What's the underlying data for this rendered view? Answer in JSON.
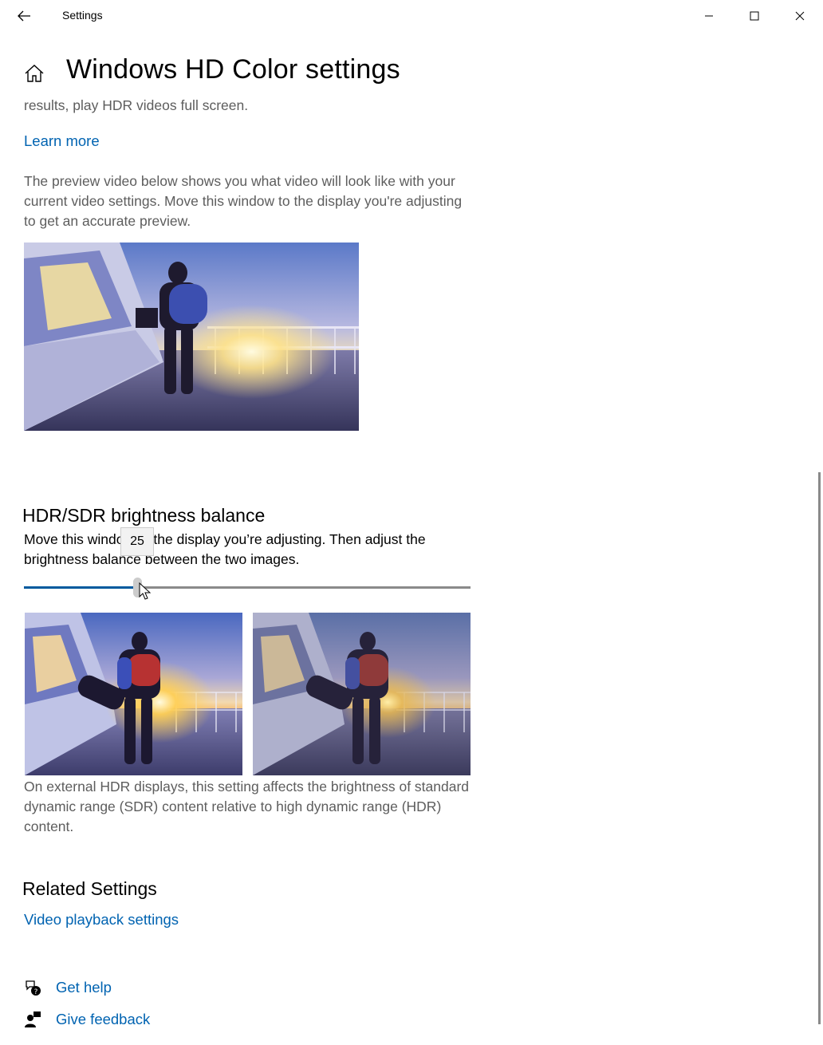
{
  "window": {
    "app_title": "Settings",
    "controls": [
      "minimize",
      "maximize",
      "close"
    ]
  },
  "page": {
    "title": "Windows HD Color settings",
    "intro_tail": "results, play HDR videos full screen.",
    "learn_more": "Learn more",
    "preview_desc": "The preview video below shows you what video will look like with your current video settings. Move this window to the display you're adjusting to get an accurate preview."
  },
  "balance": {
    "heading": "HDR/SDR brightness balance",
    "instruction": "Move this window to the display you’re adjusting. Then adjust the brightness balance between the two images.",
    "slider_value": "25",
    "slider_fraction": 0.25,
    "footnote": "On external HDR displays, this setting affects the brightness of standard dynamic range (SDR) content relative to high dynamic range (HDR) content."
  },
  "related": {
    "heading": "Related Settings",
    "video_playback_link": "Video playback settings"
  },
  "help": {
    "get_help": "Get help",
    "give_feedback": "Give feedback"
  },
  "icons": {
    "back": "back-arrow-icon",
    "home": "home-icon",
    "help": "help-chat-icon",
    "feedback": "feedback-person-icon"
  },
  "colors": {
    "accent": "#0063b1",
    "slider_fill": "#005a9e",
    "secondary_text": "#5d5d5d"
  }
}
